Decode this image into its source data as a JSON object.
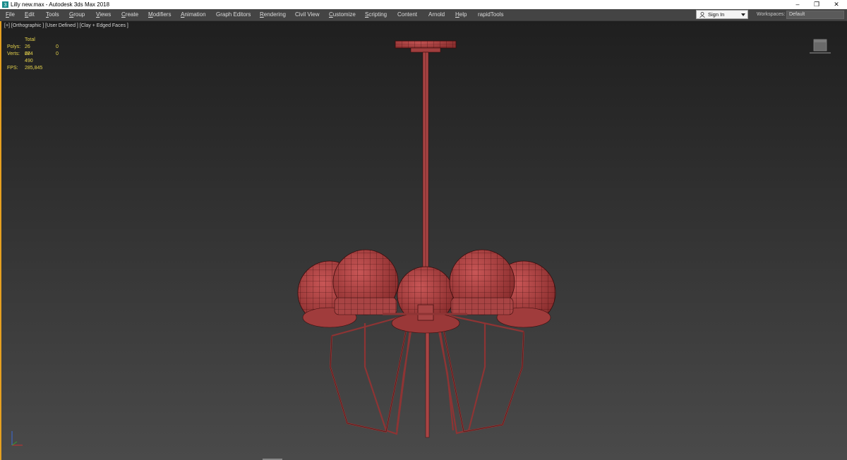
{
  "window": {
    "title": "Lilly new.max - Autodesk 3ds Max 2018",
    "controls": [
      "–",
      "❐",
      "✕"
    ]
  },
  "menu": [
    {
      "label": "File",
      "u": "F",
      "rest": "ile"
    },
    {
      "label": "Edit",
      "u": "E",
      "rest": "dit"
    },
    {
      "label": "Tools",
      "u": "T",
      "rest": "ools"
    },
    {
      "label": "Group",
      "u": "G",
      "rest": "roup"
    },
    {
      "label": "Views",
      "u": "V",
      "rest": "iews"
    },
    {
      "label": "Create",
      "u": "C",
      "rest": "reate"
    },
    {
      "label": "Modifiers",
      "u": "M",
      "rest": "odifiers"
    },
    {
      "label": "Animation",
      "u": "A",
      "rest": "nimation"
    },
    {
      "label": "Graph Editors",
      "u": "",
      "rest": "Graph Editors"
    },
    {
      "label": "Rendering",
      "u": "R",
      "rest": "endering"
    },
    {
      "label": "Civil View",
      "u": "",
      "rest": "Civil View"
    },
    {
      "label": "Customize",
      "u": "C",
      "rest": "ustomize"
    },
    {
      "label": "Scripting",
      "u": "S",
      "rest": "cripting"
    },
    {
      "label": "Content",
      "u": "",
      "rest": "Content"
    },
    {
      "label": "Arnold",
      "u": "",
      "rest": "Arnold"
    },
    {
      "label": "Help",
      "u": "H",
      "rest": "elp"
    },
    {
      "label": "rapidTools",
      "u": "",
      "rest": "rapidTools"
    }
  ],
  "account": {
    "signin_label": "Sign In"
  },
  "workspaces": {
    "label": "Workspaces:",
    "value": "Default"
  },
  "viewport": {
    "label": "[+] [Orthographic ] [User Defined ] [Clay + Edged Faces ]",
    "stats": {
      "header": "Total",
      "polys_label": "Polys:",
      "polys_total": "26 684",
      "polys_sel": "0",
      "verts_label": "Verts:",
      "verts_total": "27 490",
      "verts_sel": "0",
      "fps_label": "FPS:",
      "fps_value": "285,845"
    }
  },
  "colors": {
    "model": "#b34848",
    "wire": "#3a0c0c",
    "stats": "#e6d34c",
    "viewport_border": "#e6a020"
  }
}
